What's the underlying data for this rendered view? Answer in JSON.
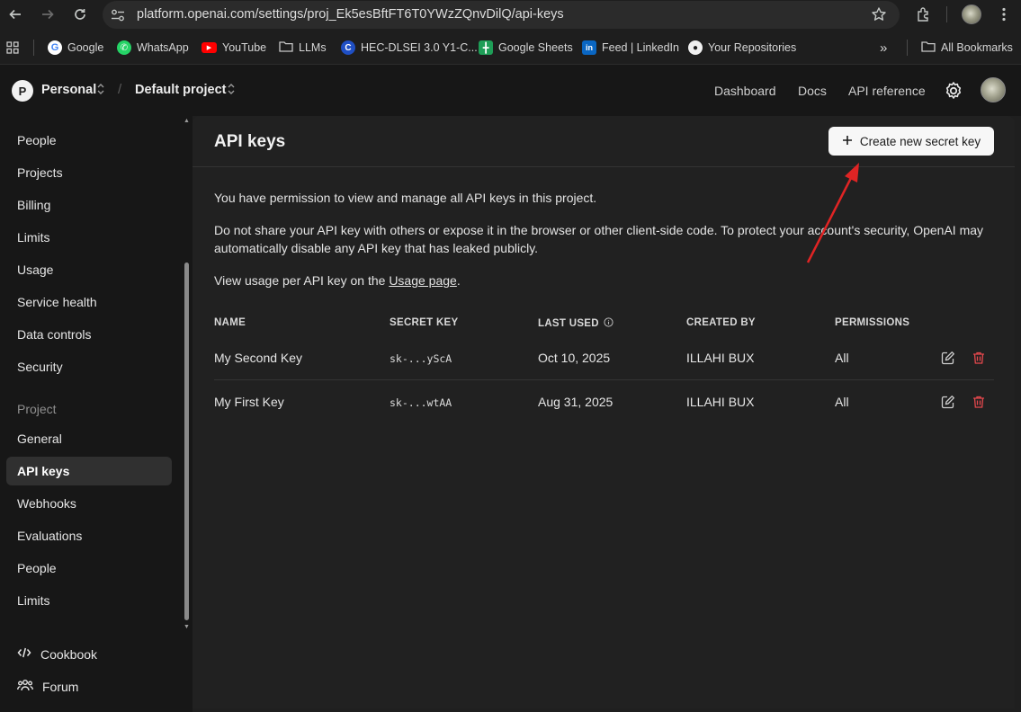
{
  "browser": {
    "url": "platform.openai.com/settings/proj_Ek5esBftFT6T0YWzZQnvDilQ/api-keys",
    "bookmarks": [
      "Google",
      "WhatsApp",
      "YouTube",
      "LLMs",
      "HEC-DLSEI 3.0 Y1-C...",
      "Google Sheets",
      "Feed | LinkedIn",
      "Your Repositories"
    ],
    "more_label": "»",
    "all_bookmarks": "All Bookmarks"
  },
  "header": {
    "org_initial": "P",
    "org_name": "Personal",
    "project_name": "Default project",
    "links": [
      "Dashboard",
      "Docs",
      "API reference"
    ]
  },
  "sidebar": {
    "org_items": [
      "People",
      "Projects",
      "Billing",
      "Limits",
      "Usage",
      "Service health",
      "Data controls",
      "Security"
    ],
    "project_section": "Project",
    "project_items": [
      "General",
      "API keys",
      "Webhooks",
      "Evaluations",
      "People",
      "Limits"
    ],
    "active_item": "API keys",
    "footer": [
      "Cookbook",
      "Forum"
    ]
  },
  "main": {
    "title": "API keys",
    "create_button": "Create new secret key",
    "para1": "You have permission to view and manage all API keys in this project.",
    "para2": "Do not share your API key with others or expose it in the browser or other client-side code. To protect your account's security, OpenAI may automatically disable any API key that has leaked publicly.",
    "para3_prefix": "View usage per API key on the ",
    "para3_link": "Usage page",
    "para3_suffix": ".",
    "columns": [
      "NAME",
      "SECRET KEY",
      "LAST USED",
      "CREATED BY",
      "PERMISSIONS"
    ],
    "rows": [
      {
        "name": "My Second Key",
        "secret": "sk-...yScA",
        "last_used": "Oct 10, 2025",
        "created_by": "ILLAHI BUX",
        "permissions": "All"
      },
      {
        "name": "My First Key",
        "secret": "sk-...wtAA",
        "last_used": "Aug 31, 2025",
        "created_by": "ILLAHI BUX",
        "permissions": "All"
      }
    ]
  },
  "colors": {
    "accent_arrow": "#e02424",
    "delete_icon": "#e5484d",
    "background": "#212121"
  }
}
